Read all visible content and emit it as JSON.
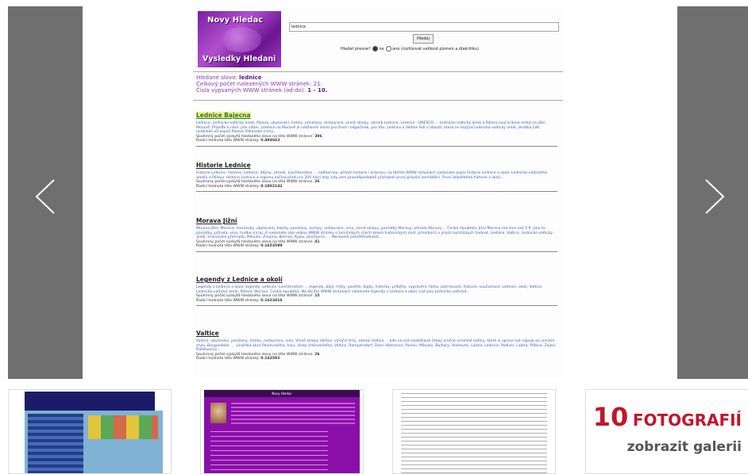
{
  "screenshot": {
    "logo_line1": "Novy Hledac",
    "logo_line2": "Vysledky Hledani",
    "search_value": "lednice",
    "search_button": "Hledej",
    "options_label": "Hledat presne?",
    "opt_no": "ne",
    "opt_yes": "ano (rozlišovat velikost písmen a diakritiku)",
    "summary_word_label": "Hledané slovo:",
    "summary_word": "lednice",
    "summary_total": "Celkový počet nalezených WWW stránek: 21.",
    "summary_range_label": "Čísla vypsaných WWW stránek (od-do):",
    "summary_range": "1 - 10.",
    "results": [
      {
        "title": "Lednice Bajecna",
        "snippet": "Lednice, Lednicko-valtický areál, Pálava, ubytování, hotely, penziony, restaurace, vinné sklepy, zámek Lednice, Lednice - UNESCO ... Lednicko-valtický areál a Pálava jsou krásná místa na Jižní Moravě. Přijeďte k nám, jste vítáni. Lednice na Moravě je nádherné místo pro život i odpočinek, pro Vás. Lednice a Valtice leží v oblasti, která se nazývá Lednicko-valtický areál, zkratka LVA, nedaleko od kopců Pálava (Pálavské vrchy...",
        "count_label": "Souhrnný počet výskytů hledaného slova na této WWW stránce:",
        "count": "306",
        "rank_label": "Řadící hodnota této WWW stránky:",
        "rank": "0.494663"
      },
      {
        "title": "Historie Lednice",
        "snippet": "Historie Lednice, historie, Lednice, dějiny, zámek, Liechtenstein ... nádhernou, přitom historie i krásnou, na těchto WWW stránkách naleznete popis historie Lednice a okolí. Lednicko-valtického areálu a Pálavy. Historie Lednice a regionu začíná před cca 200 tisíci lety, kdy sem pravděpodobně přicházeli první pravěcí zemědělci. První doložitelná historie z okolí...",
        "count_label": "Souhrnný počet výskytů hledaného slova na této WWW stránce:",
        "count": "26",
        "rank_label": "Řadící hodnota této WWW stránky:",
        "rank": "0.1882142"
      },
      {
        "title": "Morava Jižní",
        "snippet": "Morava Jižní, Morava, moravský, ubytování, hotely, penziony, kempy, restaurace, vino, vinné sklepy, památky Moravy, příroda Moravy ... Česká republika, Jižní Morava má více než 5 P, jsou to památky, příroda, vino, hudba a kraj. A naleznete zde velkou WWW stránku o turistických cílech kolem historických míst, přírodních a jiných turistických hodnot. Lednice, Valtice, Lednicko-valtický areál, Vranovská přehrada, Mikulov, Znojmo, Bzenec, Kyjov, Jevišovice, ... Moravské pamětihodnosti...",
        "count_label": "Souhrnný počet výskytů hledaného slova na této WWW stránce:",
        "count": "41",
        "rank_label": "Řadící hodnota této WWW stránky:",
        "rank": "0.1653599"
      },
      {
        "title": "Legendy z Lednice a okolí",
        "snippet": "Legendy z Lednice a okolí, legendy, Lednice, Liechtenstein ... legendy, báje, mýty, pověsti, bajky, historky, příběhy, vyprávění, fakta, zajímavosti, historie, současnost. Lednice, okolí, Valtice, Lednicko-valtický areál, Pálava, Morava. Česká republika. Na těchto WWW stránkách naleznete legendy z Lednice a okolí, což jsou Lednicko-valtické...",
        "count_label": "Souhrnný počet výskytů hledaného slova na této WWW stránce:",
        "count": "15",
        "rank_label": "Řadící hodnota této WWW stránky:",
        "rank": "0.1623416"
      },
      {
        "title": "Valtice",
        "snippet": "Valtice, ubytování, penziony, hotely, restaurace, vino, Vinné sklepy Valtice, výroční trhy, zámek Valtice ... kde na své nedočkavé čekají zručné vinařské rodiny, které si upraví své nápoje po vinném stylu. Burgundské, ... vinařská akce Pavlovského, hory, sklep Vrboveckého, Valtice, Rampersdorf, Dolní Věstonice, Pavlov, Mikulov, Bulhary, Hlohovec, Ladná, Lednice, Podivín, Ladná, Přibice, Zajeci, Ratíškovice...",
        "count_label": "Souhrnný počet výskytů hledaného slova na této WWW stránce:",
        "count": "26",
        "rank_label": "Řadící hodnota této WWW stránky:",
        "rank": "0.142592"
      }
    ]
  },
  "thumbnails": {
    "thumb2_header": "Novy Hledac",
    "thumb2_bar": "Novy Hledac"
  },
  "gallery": {
    "count": "10",
    "count_word": "FOTOGRAFIÍ",
    "link": "zobrazit galerii"
  },
  "icons": {
    "prev": "chevron-left-icon",
    "next": "chevron-right-icon"
  },
  "colors": {
    "panel": "#6f6f6f",
    "gallery_accent": "#c0172b"
  }
}
